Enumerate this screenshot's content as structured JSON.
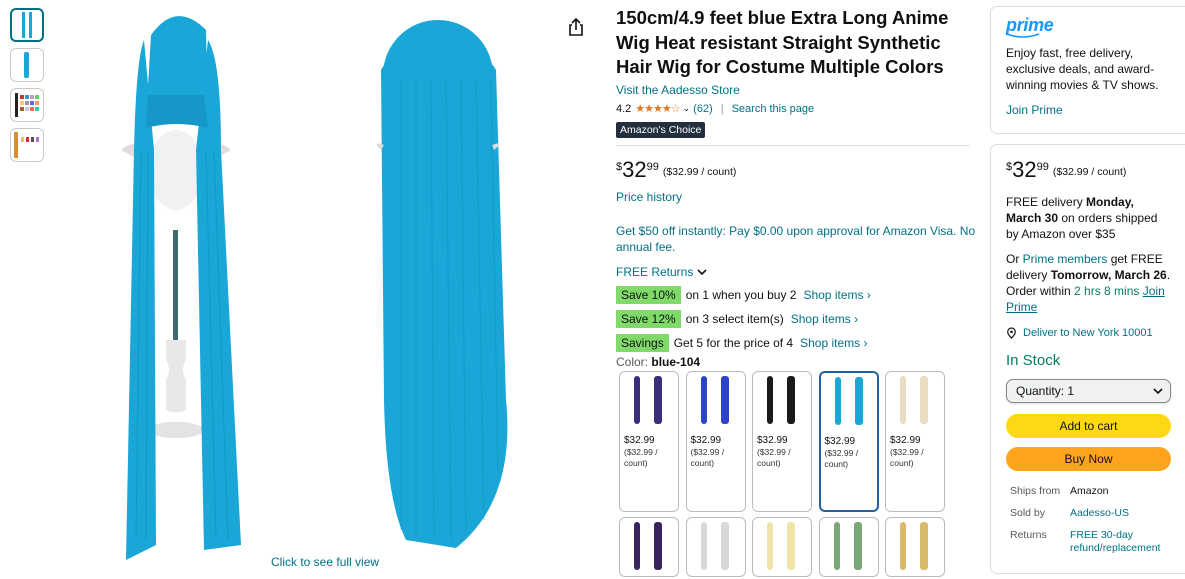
{
  "thumbnails": [
    {
      "name": "thumbnail-1"
    },
    {
      "name": "thumbnail-2"
    },
    {
      "name": "thumbnail-3"
    },
    {
      "name": "thumbnail-4"
    }
  ],
  "main_image": {
    "caption": "Click to see full view"
  },
  "product": {
    "title": "150cm/4.9 feet blue Extra Long Anime Wig Heat resistant Straight Synthetic Hair Wig for Costume Multiple Colors",
    "store_link": "Visit the Aadesso Store",
    "rating": "4.2",
    "rating_stars": "★★★★☆",
    "review_count": "(62)",
    "search_page": "Search this page",
    "badge": "Amazon's Choice",
    "price": {
      "symbol": "$",
      "whole": "32",
      "fraction": "99",
      "unit": "($32.99 / count)"
    },
    "price_history": "Price history",
    "visa_offer": "Get $50 off instantly: Pay $0.00 upon approval for Amazon Visa. No annual fee.",
    "returns": "FREE Returns",
    "promotions": [
      {
        "badge": "Save 10%",
        "text": "on 1 when you buy 2",
        "link": "Shop items ›"
      },
      {
        "badge": "Save 12%",
        "text": "on 3 select item(s)",
        "link": "Shop items ›"
      },
      {
        "badge": "Savings",
        "text": "Get 5 for the price of 4",
        "link": "Shop items ›"
      }
    ],
    "color_label": "Color:",
    "color_value": "blue-104",
    "swatches": [
      {
        "price": "$32.99",
        "per": "($32.99 / count)",
        "color": "#3a2d7a",
        "selected": false
      },
      {
        "price": "$32.99",
        "per": "($32.99 / count)",
        "color": "#2a45c8",
        "selected": false
      },
      {
        "price": "$32.99",
        "per": "($32.99 / count)",
        "color": "#1a1a1a",
        "selected": false
      },
      {
        "price": "$32.99",
        "per": "($32.99 / count)",
        "color": "#1aa6d6",
        "selected": true
      },
      {
        "price": "$32.99",
        "per": "($32.99 / count)",
        "color": "#e9dcc0",
        "selected": false
      }
    ],
    "swatches_row2": [
      {
        "color": "#3a2460"
      },
      {
        "color": "#d8d8d8"
      },
      {
        "color": "#efe3a8"
      },
      {
        "color": "#7aa878"
      },
      {
        "color": "#d9b96a"
      }
    ]
  },
  "prime_box": {
    "logo": "prime",
    "text": "Enjoy fast, free delivery, exclusive deals, and award-winning movies & TV shows.",
    "join": "Join Prime"
  },
  "buy_box": {
    "price": {
      "symbol": "$",
      "whole": "32",
      "fraction": "99",
      "unit": "($32.99 / count)"
    },
    "delivery_prefix": "FREE delivery ",
    "delivery_date": "Monday, March 30",
    "delivery_suffix": " on orders shipped by Amazon over $35",
    "or": "Or ",
    "prime_members": "Prime members",
    "get_free": " get FREE delivery ",
    "fast_date": "Tomorrow, March 26",
    "order_within": ". Order within ",
    "countdown": "2 hrs 8 mins",
    "join_prime": "Join Prime",
    "deliver_to": "Deliver to New York 10001",
    "stock": "In Stock",
    "quantity": "Quantity: 1",
    "add_to_cart": "Add to cart",
    "buy_now": "Buy Now",
    "details": [
      {
        "k": "Ships from",
        "v": "Amazon",
        "link": false
      },
      {
        "k": "Sold by",
        "v": "Aadesso-US",
        "link": true
      },
      {
        "k": "Returns",
        "v": "FREE 30-day refund/replacement",
        "link": true
      }
    ]
  },
  "colors": {
    "wig": "#1aa6d6",
    "link": "#007185",
    "cart": "#ffd814",
    "buy": "#ffa41c",
    "promo": "#7fda69",
    "stock": "#067d62"
  }
}
